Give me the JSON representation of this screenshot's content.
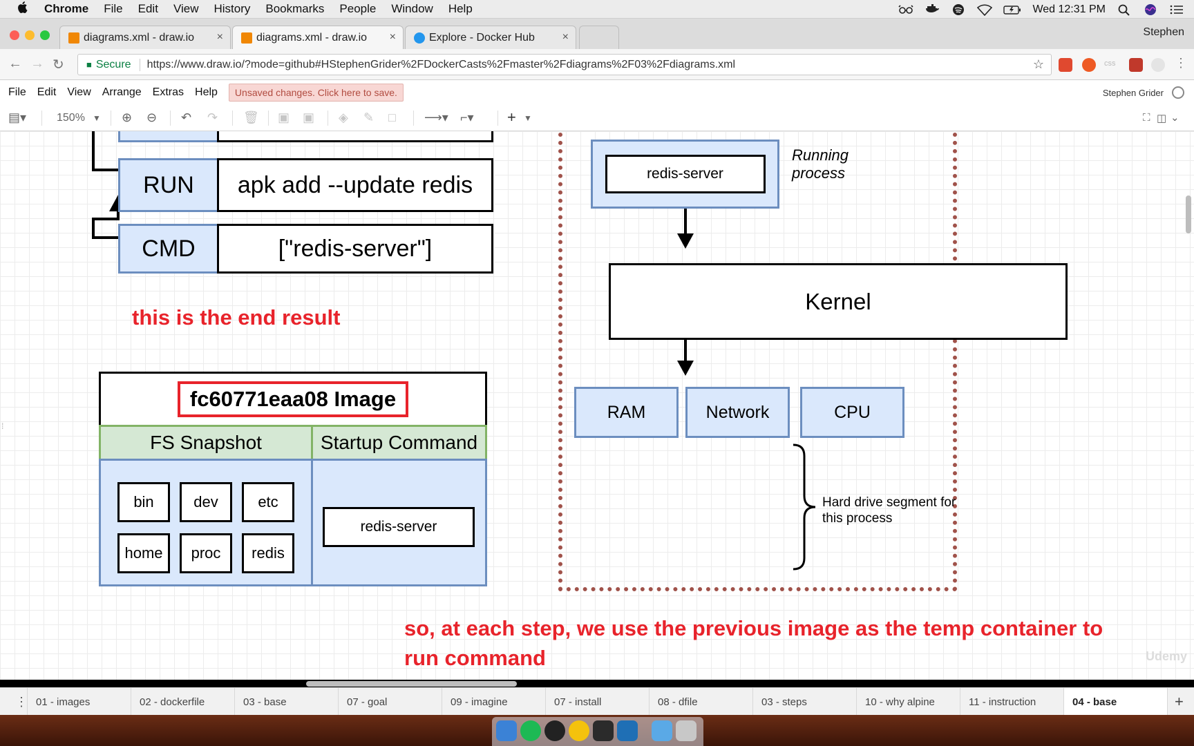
{
  "macbar": {
    "apple": "",
    "app": "Chrome",
    "menus": [
      "File",
      "Edit",
      "View",
      "History",
      "Bookmarks",
      "People",
      "Window",
      "Help"
    ],
    "clock": "Wed 12:31 PM"
  },
  "tabs": [
    {
      "title": "diagrams.xml - draw.io",
      "close": "×"
    },
    {
      "title": "diagrams.xml - draw.io",
      "close": "×"
    },
    {
      "title": "Explore - Docker Hub",
      "close": "×"
    }
  ],
  "profile": "Stephen",
  "address": {
    "secure": "Secure",
    "url": "https://www.draw.io/?mode=github#HStephenGrider%2FDockerCasts%2Fmaster%2Fdiagrams%2F03%2Fdiagrams.xml"
  },
  "drawio_menu": {
    "items": [
      "File",
      "Edit",
      "View",
      "Arrange",
      "Extras",
      "Help"
    ],
    "unsaved": "Unsaved changes. Click here to save.",
    "user": "Stephen Grider"
  },
  "toolbar": {
    "zoom": "150%"
  },
  "diagram": {
    "run_label": "RUN",
    "run_value": "apk add --update redis",
    "cmd_label": "CMD",
    "cmd_value": "[\"redis-server\"]",
    "note_end": "this is the end result",
    "image_title": "fc60771eaa08 Image",
    "fs_header": "FS Snapshot",
    "startup_header": "Startup Command",
    "folders": [
      "bin",
      "dev",
      "etc",
      "home",
      "proc",
      "redis"
    ],
    "startup_cmd": "redis-server",
    "running_process_box": "redis-server",
    "running_process_label": "Running process",
    "kernel": "Kernel",
    "resources": [
      "RAM",
      "Network",
      "CPU"
    ],
    "hdd_label": "Hard drive segment for this process",
    "note_bottom": "so, at each step, we use the previous image as the temp container to run command",
    "watermark": "Udemy"
  },
  "page_tabs": [
    {
      "label": "01 - images"
    },
    {
      "label": "02 - dockerfile"
    },
    {
      "label": "03 - base"
    },
    {
      "label": "07 - goal"
    },
    {
      "label": "09 - imagine"
    },
    {
      "label": "07 - install"
    },
    {
      "label": "08 - dfile"
    },
    {
      "label": "03 - steps"
    },
    {
      "label": "10 - why alpine"
    },
    {
      "label": "11 - instruction"
    },
    {
      "label": "04 - base",
      "active": true
    }
  ],
  "colors": {
    "accent_red": "#e8232b",
    "blue_fill": "#dae8fc",
    "blue_border": "#6c8ebf",
    "green_fill": "#d5e8d4",
    "green_border": "#82b366",
    "dotted_border": "#a0524a"
  }
}
